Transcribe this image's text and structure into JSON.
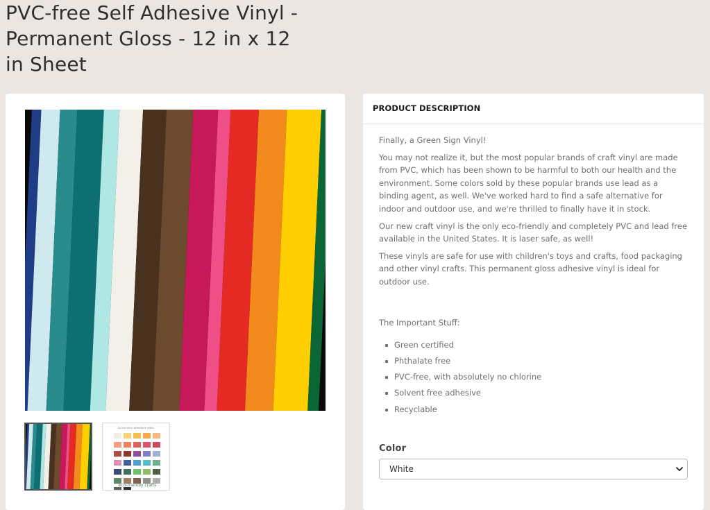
{
  "product": {
    "title": "PVC-free Self Adhesive Vinyl - Permanent Gloss - 12 in x 12 in Sheet"
  },
  "gallery": {
    "stripe_colors": [
      "#1e3d86",
      "#cfe9ef",
      "#2a8b8d",
      "#0e6f72",
      "#aee7e4",
      "#f3f0e9",
      "#48321f",
      "#6b4a2e",
      "#c7195a",
      "#ef4e86",
      "#e52a24",
      "#f38a1d",
      "#ffcf00",
      "#0b6635"
    ],
    "swatch_chart_caption": "GLOSS SELF ADHESIVE VINYL",
    "swatch_chart_brand": "eco-friendly crafts",
    "swatch_colors": [
      "#f3ede2",
      "#f5d37b",
      "#f4c04d",
      "#f4a94a",
      "#f7b787",
      "#f0a080",
      "#ef8060",
      "#e3605a",
      "#e05070",
      "#d0485a",
      "#aa5040",
      "#903828",
      "#8a5098",
      "#8080c8",
      "#a0b0d8",
      "#e090b0",
      "#4060a0",
      "#50a0d0",
      "#50c0d0",
      "#70b090",
      "#3a4a78",
      "#407060",
      "#70c070",
      "#90c060",
      "#506040",
      "#5a8a6a",
      "#a08060",
      "#806050",
      "#909090",
      "#b0b0b0",
      "#606060",
      "#303030"
    ]
  },
  "description": {
    "header": "PRODUCT DESCRIPTION",
    "intro": "Finally, a Green Sign Vinyl!",
    "p1": "You may not realize it, but the most popular brands of craft vinyl are made from PVC, which has been shown to be harmful to both our health and the environment. Some colors sold by these popular brands use lead as a binding agent, as well. We've worked hard to find a safe alternative for indoor and outdoor use, and we're thrilled to finally have it in stock.",
    "p2": "Our new craft vinyl is the only eco-friendly and completely PVC and lead free available in the United States. It is laser safe, as well!",
    "p3": "These vinyls are safe for use with children's toys and crafts, food packaging and other vinyl crafts. This permanent gloss adhesive vinyl is ideal for outdoor use.",
    "important_heading": "The Important Stuff:",
    "features": [
      "Green certified",
      "Phthalate free",
      "PVC-free, with absolutely no chlorine",
      "Solvent free adhesive",
      "Recyclable"
    ]
  },
  "options": {
    "color_label": "Color",
    "color_value": "White"
  },
  "icons": {
    "select_caret": "chevron-down-icon"
  }
}
